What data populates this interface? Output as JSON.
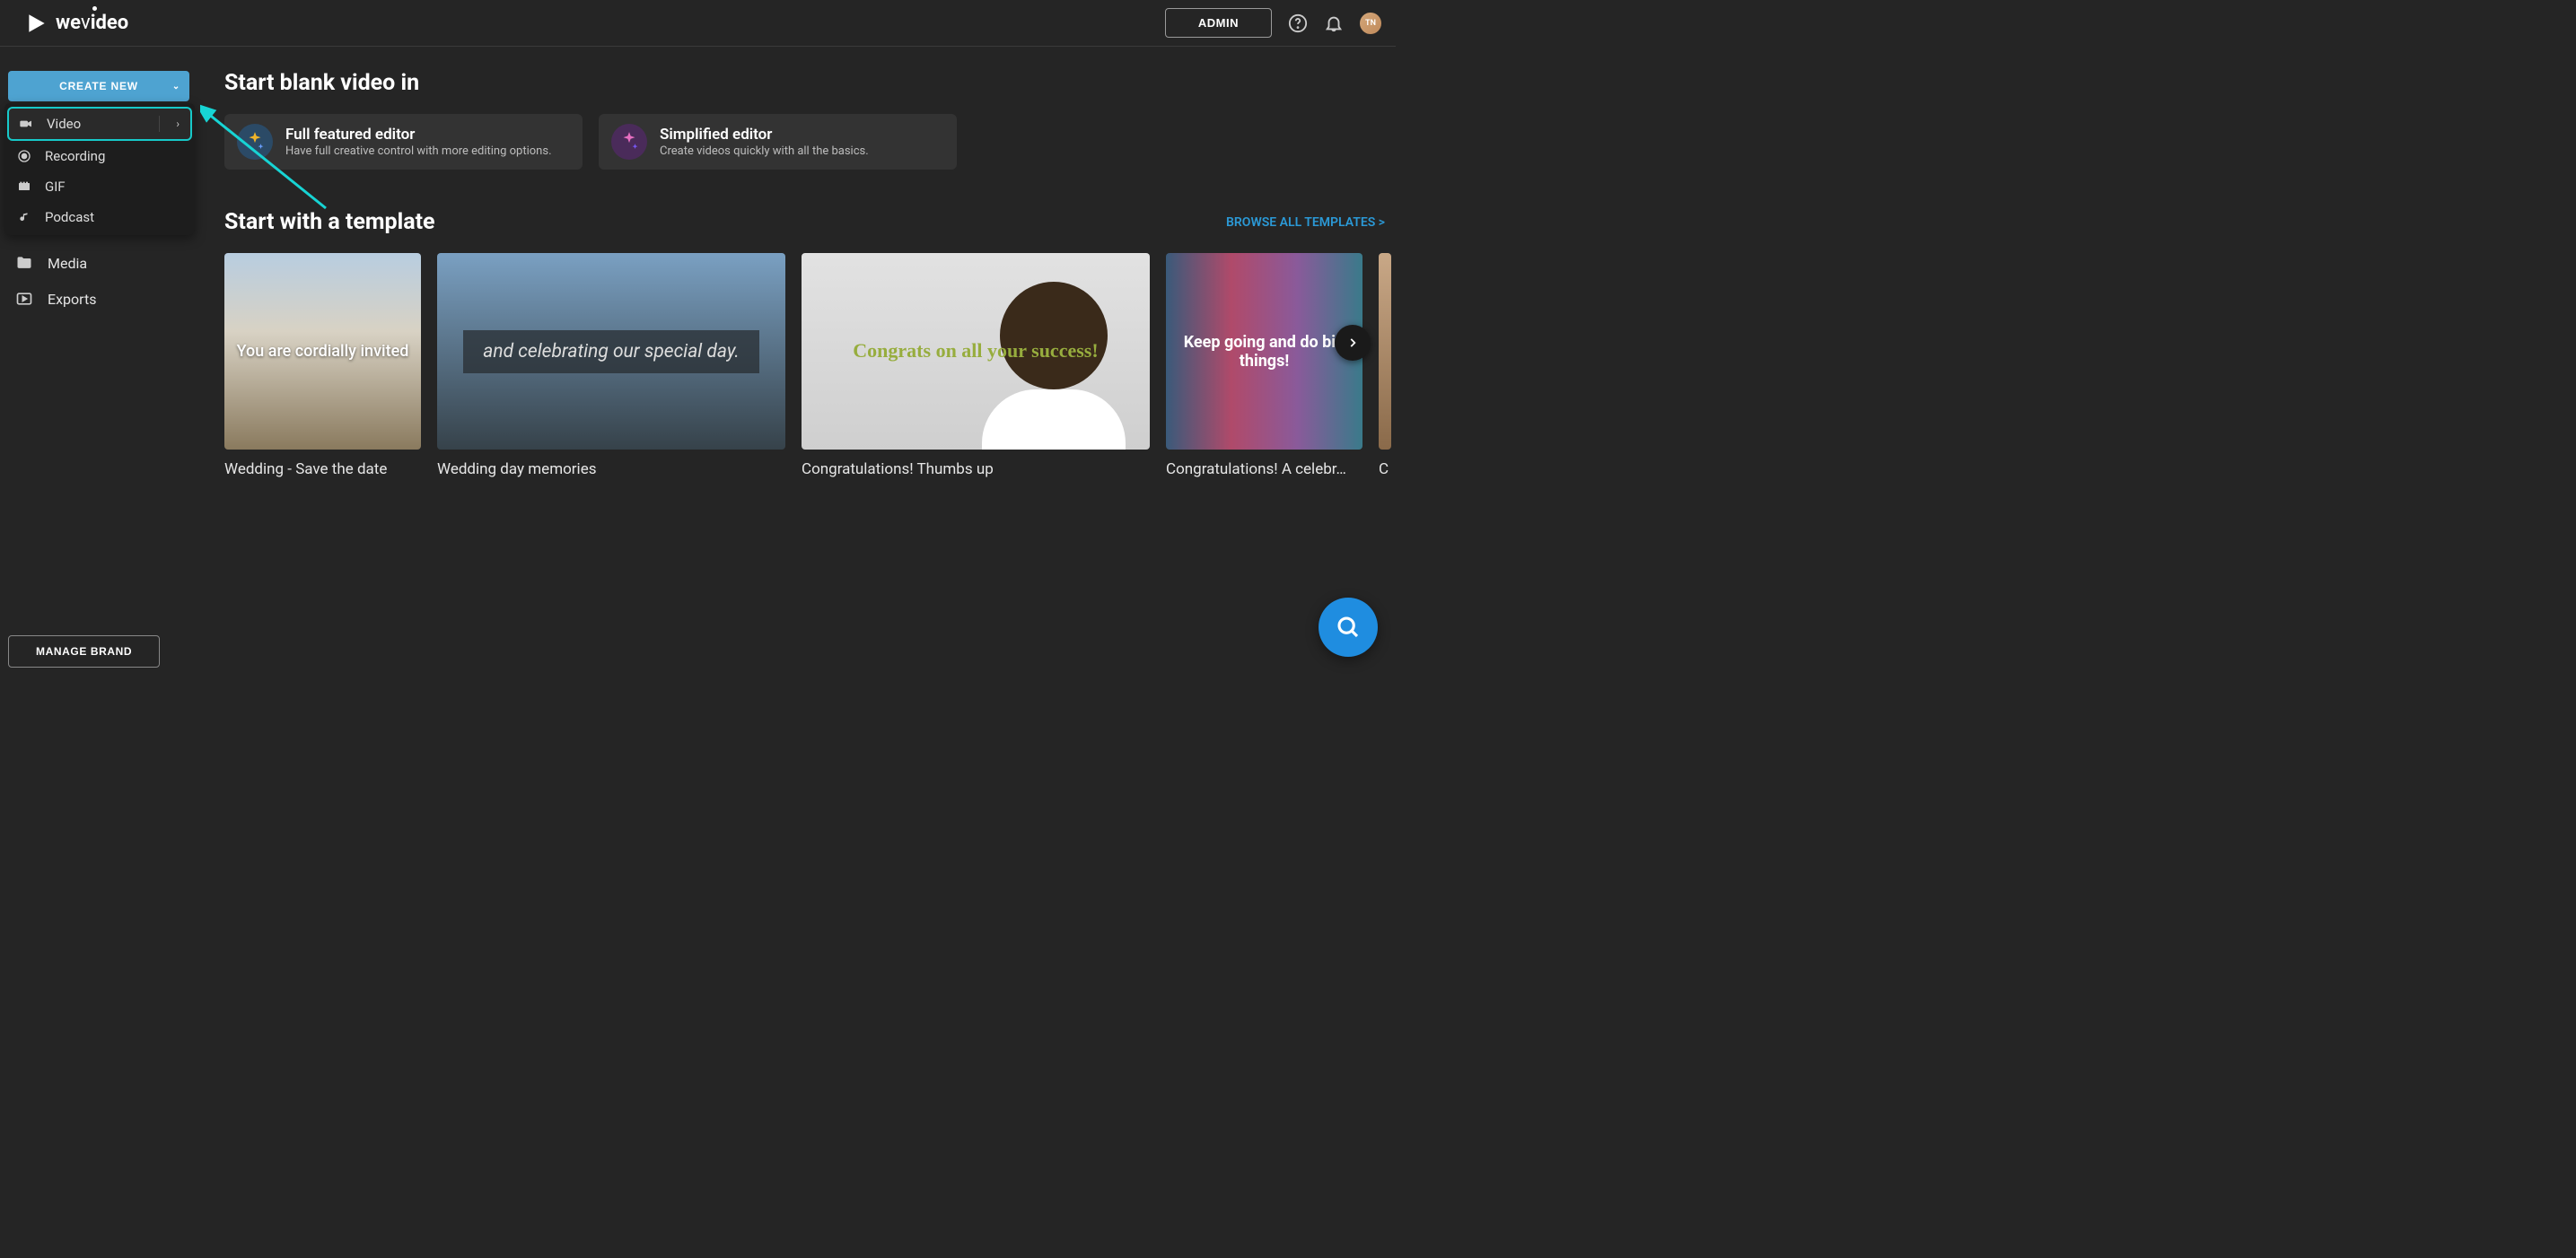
{
  "header": {
    "brand": "wevideo",
    "admin_label": "ADMIN",
    "avatar_initials": "TN"
  },
  "sidebar": {
    "create_label": "CREATE NEW",
    "flyout": [
      {
        "label": "Video",
        "highlighted": true,
        "has_sub": true
      },
      {
        "label": "Recording"
      },
      {
        "label": "GIF"
      },
      {
        "label": "Podcast"
      }
    ],
    "nav": [
      {
        "label": "Media"
      },
      {
        "label": "Exports"
      }
    ],
    "manage_brand_label": "MANAGE BRAND"
  },
  "main": {
    "blank_heading": "Start blank video in",
    "editors": [
      {
        "title": "Full featured editor",
        "sub": "Have full creative control with more editing options."
      },
      {
        "title": "Simplified editor",
        "sub": "Create videos quickly with all the basics."
      }
    ],
    "template_heading": "Start with a template",
    "browse_link": "BROWSE ALL TEMPLATES >",
    "templates": [
      {
        "caption": "Wedding - Save the date",
        "overlay": "You are cordially invited"
      },
      {
        "caption": "Wedding day memories",
        "overlay": "and celebrating our special day."
      },
      {
        "caption": "Congratulations! Thumbs up",
        "overlay": "Congrats on all your success!"
      },
      {
        "caption": "Congratulations! A celebr…",
        "overlay": "Keep going and do big things!"
      },
      {
        "caption": "C",
        "overlay": ""
      }
    ]
  }
}
